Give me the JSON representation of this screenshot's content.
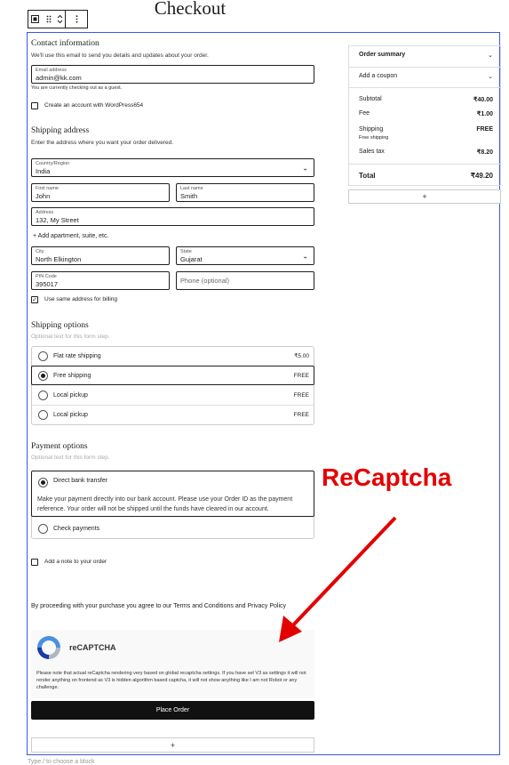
{
  "page_title": "Checkout",
  "toolbar": {
    "icons": [
      "block-type-icon",
      "drag-handle-icon",
      "move-updown-icon",
      "more-options-icon"
    ]
  },
  "contact": {
    "heading": "Contact information",
    "desc": "We'll use this email to send you details and updates about your order.",
    "email_label": "Email address",
    "email_value": "admin@kk.com",
    "guest_note": "You are currently checking out as a guest.",
    "create_account": "Create an account with WordPress654"
  },
  "shipping_address": {
    "heading": "Shipping address",
    "desc": "Enter the address where you want your order delivered.",
    "country_label": "Country/Region",
    "country_value": "India",
    "first_name_label": "First name",
    "first_name_value": "John",
    "last_name_label": "Last name",
    "last_name_value": "Smith",
    "address_label": "Address",
    "address_value": "132, My Street",
    "add_apartment": "+ Add apartment, suite, etc.",
    "city_label": "City",
    "city_value": "North Elkington",
    "state_label": "State",
    "state_value": "Gujarat",
    "pin_label": "PIN Code",
    "pin_value": "395017",
    "phone_placeholder": "Phone (optional)",
    "same_billing": "Use same address for billing"
  },
  "shipping_options": {
    "heading": "Shipping options",
    "desc": "Optional text for this form step.",
    "options": [
      {
        "label": "Flat rate shipping",
        "price": "₹5.00",
        "selected": false
      },
      {
        "label": "Free shipping",
        "price": "FREE",
        "selected": true
      },
      {
        "label": "Local pickup",
        "price": "FREE",
        "selected": false
      },
      {
        "label": "Local pickup",
        "price": "FREE",
        "selected": false
      }
    ]
  },
  "payment": {
    "heading": "Payment options",
    "desc": "Optional text for this form step.",
    "bank_label": "Direct bank transfer",
    "bank_desc": "Make your payment directly into our bank account. Please use your Order ID as the payment reference. Your order will not be shipped until the funds have cleared in our account.",
    "check_label": "Check payments"
  },
  "note_label": "Add a note to your order",
  "terms": "By proceeding with your purchase you agree to our Terms and Conditions and Privacy Policy",
  "recaptcha": {
    "title": "reCAPTCHA",
    "note": "Please note that actual reCaptcha rendering very based on global recaptcha settings. If you have set V3 as settings it will not render anything on frontend as V3 is hidden algorithm based captcha, it will not show anything like I am not Robot or any challenge."
  },
  "place_order": "Place Order",
  "footer_hint": "Type / to choose a block",
  "summary": {
    "title": "Order summary",
    "coupon": "Add a coupon",
    "subtotal_label": "Subtotal",
    "subtotal": "₹40.00",
    "fee_label": "Fee",
    "fee": "₹1.00",
    "shipping_label": "Shipping",
    "shipping": "FREE",
    "shipping_sub": "Free shipping",
    "tax_label": "Sales tax",
    "tax": "₹8.20",
    "total_label": "Total",
    "total": "₹49.20"
  },
  "annotation": {
    "text": "ReCaptcha",
    "color": "#e30000"
  },
  "colors": {
    "accent": "#3858e9",
    "annotation": "#e30000",
    "button": "#111111"
  }
}
